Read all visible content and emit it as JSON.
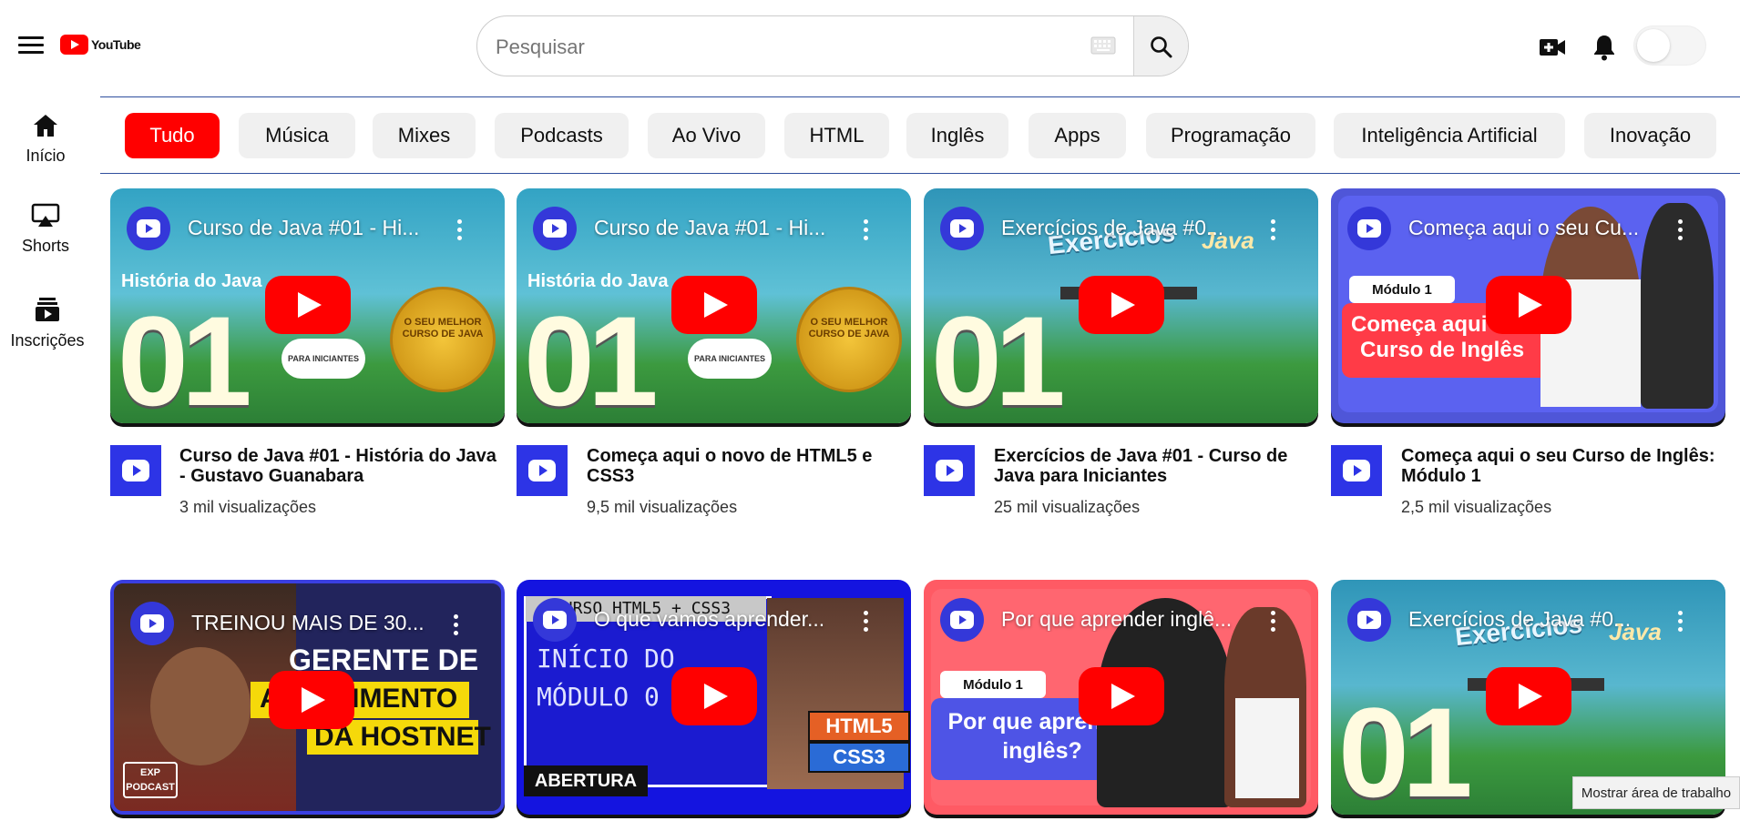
{
  "app": {
    "logo_text": "YouTube"
  },
  "header": {
    "search_placeholder": "Pesquisar",
    "icons": [
      "menu-icon",
      "keyboard-icon",
      "search-icon",
      "create-video-icon",
      "notifications-icon",
      "theme-toggle"
    ]
  },
  "sidebar": {
    "items": [
      {
        "label": "Início",
        "icon": "home-icon"
      },
      {
        "label": "Shorts",
        "icon": "shorts-icon"
      },
      {
        "label": "Inscrições",
        "icon": "subscriptions-icon"
      }
    ]
  },
  "chips": [
    "Tudo",
    "Música",
    "Mixes",
    "Podcasts",
    "Ao Vivo",
    "HTML",
    "Inglês",
    "Apps",
    "Programação",
    "Inteligência Artificial",
    "Inovação"
  ],
  "chips_active": "Tudo",
  "videos": [
    {
      "overlay_title": "Curso de Java #01 - Hi...",
      "title": "Curso de Java #01 - História do Java - Gustavo Guanabara",
      "views": "3 mil visualizações",
      "thumb_texts": [
        "História do Java",
        "01",
        "O SEU MELHOR CURSO DE JAVA",
        "PARA INICIANTES"
      ]
    },
    {
      "overlay_title": "Curso de Java #01 - Hi...",
      "title": "Começa aqui o novo de HTML5 e CSS3",
      "views": "9,5 mil visualizações",
      "thumb_texts": [
        "História do Java",
        "01",
        "O SEU MELHOR CURSO DE JAVA",
        "PARA INICIANTES"
      ]
    },
    {
      "overlay_title": "Exercícios de Java #0...",
      "title": "Exercícios de Java #01 - Curso de Java para Iniciantes",
      "views": "25 mil visualizações",
      "thumb_texts": [
        "Exercícios",
        "Java",
        "01"
      ]
    },
    {
      "overlay_title": "Começa aqui o seu Cu...",
      "title": "Começa aqui o seu Curso de Inglês: Módulo 1",
      "views": "2,5 mil visualizações",
      "thumb_texts": [
        "Módulo 1",
        "Começa aqui",
        "Curso de Inglês"
      ]
    },
    {
      "overlay_title": "TREINOU MAIS DE 30...",
      "thumb_texts": [
        "GERENTE DE",
        "ATENDIMENTO",
        "DA HOSTNET",
        "EXP PODCAST"
      ]
    },
    {
      "overlay_title": "O que vamos aprender...",
      "thumb_texts": [
        "CURSO HTML5 + CSS3",
        "INÍCIO DO MÓDULO 0",
        "ABERTURA",
        "HTML5",
        "CSS3"
      ]
    },
    {
      "overlay_title": "Por que aprender inglê...",
      "thumb_texts": [
        "Módulo 1",
        "Por que aprender inglês?"
      ]
    },
    {
      "overlay_title": "Exercícios de Java #0...",
      "thumb_texts": [
        "Exercícios",
        "Java",
        "01"
      ]
    }
  ],
  "desktop_tip": "Mostrar área de trabalho",
  "colors": {
    "accent": "#ff0000",
    "channel_blue": "#2d34e6",
    "chip_bg": "#f0f0f0"
  }
}
